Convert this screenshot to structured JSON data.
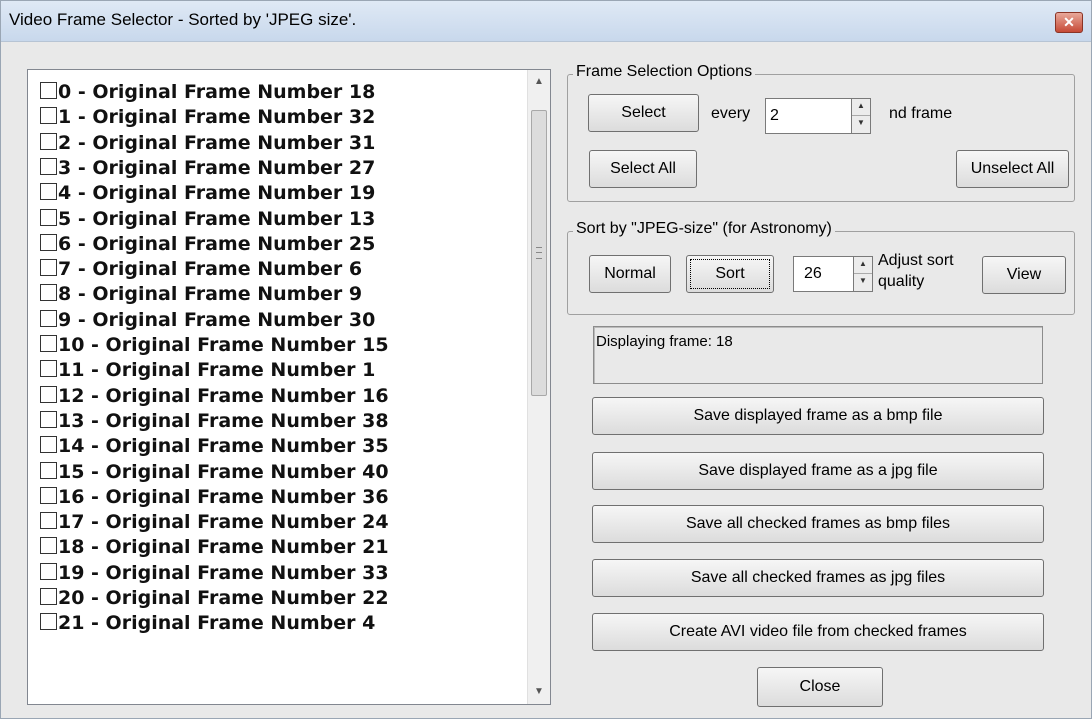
{
  "window": {
    "title": "Video Frame Selector - Sorted by 'JPEG size'.",
    "close_glyph": "✕"
  },
  "frame_list": {
    "items": [
      "0  -  Original Frame Number 18",
      "1  -  Original Frame Number 32",
      "2  -  Original Frame Number 31",
      "3  -  Original Frame Number 27",
      "4  -  Original Frame Number 19",
      "5  -  Original Frame Number 13",
      "6  -  Original Frame Number 25",
      "7  -  Original Frame Number 6",
      "8  -  Original Frame Number 9",
      "9  -  Original Frame Number 30",
      "10  -  Original Frame Number 15",
      "11  -  Original Frame Number 1",
      "12  -  Original Frame Number 16",
      "13  -  Original Frame Number 38",
      "14  -  Original Frame Number 35",
      "15  -  Original Frame Number 40",
      "16  -  Original Frame Number 36",
      "17  -  Original Frame Number 24",
      "18  -  Original Frame Number 21",
      "19  -  Original Frame Number 33",
      "20  -  Original Frame Number 22",
      "21  -  Original Frame Number 4"
    ]
  },
  "frame_selection": {
    "legend": "Frame Selection Options",
    "select_label": "Select",
    "every_label": "every",
    "every_value": "2",
    "nd_frame_label": "nd  frame",
    "select_all_label": "Select All",
    "unselect_all_label": "Unselect All"
  },
  "sort": {
    "legend": "Sort by \"JPEG-size\" (for Astronomy)",
    "normal_label": "Normal",
    "sort_label": "Sort",
    "quality_value": "26",
    "adjust_label_1": "Adjust sort",
    "adjust_label_2": "quality",
    "view_label": "View"
  },
  "status": {
    "text": "Displaying frame:  18"
  },
  "actions": {
    "save_bmp": "Save displayed frame as a bmp file",
    "save_jpg": "Save displayed frame as a jpg file",
    "save_all_bmp": "Save all checked frames as bmp files",
    "save_all_jpg": "Save all checked frames as jpg files",
    "create_avi": "Create AVI video file from checked frames",
    "close": "Close"
  }
}
